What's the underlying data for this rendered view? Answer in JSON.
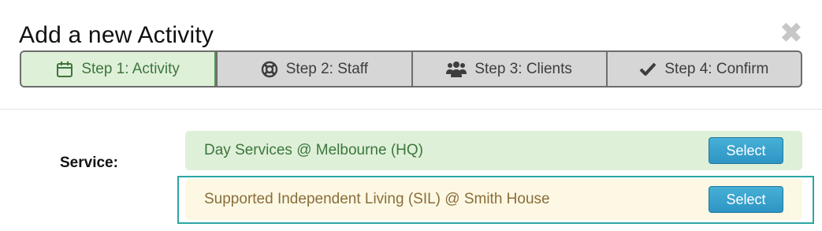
{
  "modal": {
    "title": "Add a new Activity",
    "close_glyph": "✖"
  },
  "steps": [
    {
      "label": "Step 1: Activity",
      "icon": "calendar-icon",
      "active": true
    },
    {
      "label": "Step 2: Staff",
      "icon": "lifebuoy-icon",
      "active": false
    },
    {
      "label": "Step 3: Clients",
      "icon": "users-icon",
      "active": false
    },
    {
      "label": "Step 4: Confirm",
      "icon": "check-icon",
      "active": false
    }
  ],
  "service": {
    "label": "Service:",
    "options": [
      {
        "name": "Day Services @ Melbourne (HQ)",
        "button": "Select",
        "style": "success"
      },
      {
        "name": "Supported Independent Living (SIL) @ Smith House",
        "button": "Select",
        "style": "warning",
        "highlighted": true
      }
    ]
  },
  "colors": {
    "active_step_bg": "#dff0d8",
    "active_step_text": "#3c763d",
    "success_bg": "#dff0d8",
    "warning_bg": "#fcf8e3",
    "warning_text": "#8a6d3b",
    "button_blue": "#2e95c4",
    "highlight_border": "#2ca6a4"
  }
}
